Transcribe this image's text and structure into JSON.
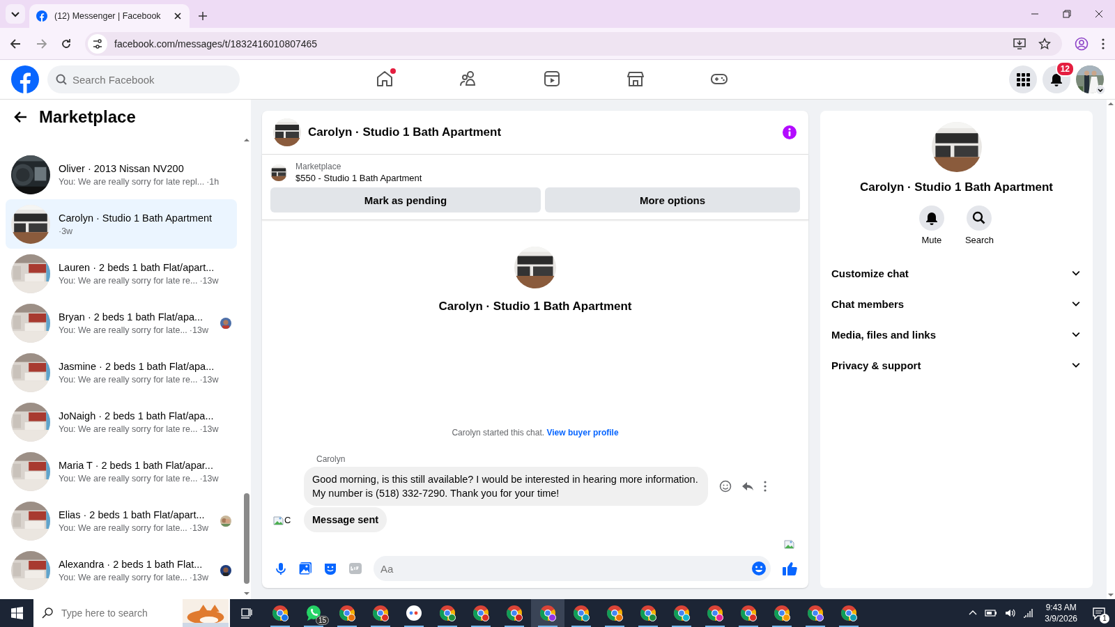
{
  "browser": {
    "tabs": [
      {
        "title": "(12) Messenger | Facebook",
        "selected": true
      }
    ],
    "url": "facebook.com/messages/t/1832416010807465"
  },
  "header": {
    "search": {
      "placeholder": "Search Facebook"
    },
    "nav": [
      {
        "kind": "home",
        "selected": false,
        "dot": true
      },
      {
        "kind": "friends",
        "selected": false,
        "dot": false
      },
      {
        "kind": "video",
        "selected": false,
        "dot": false
      },
      {
        "kind": "marketplace",
        "selected": false,
        "dot": false
      },
      {
        "kind": "gaming",
        "selected": false,
        "dot": false
      }
    ],
    "notifications_badge": "12"
  },
  "sidebar": {
    "title": "Marketplace",
    "conversations": [
      {
        "name": "Oliver · 2013 Nissan NV200",
        "preview": "You: We are really sorry for late repl...",
        "time": "·1h",
        "selected": false,
        "seen": false
      },
      {
        "name": "Carolyn · Studio 1 Bath Apartment",
        "time": "·3w",
        "selected": true,
        "seen": false
      },
      {
        "name": "Lauren · 2 beds 1 bath Flat/apart...",
        "preview": "You: We are really sorry for late re...",
        "time": "·13w",
        "selected": false,
        "seen": false
      },
      {
        "name": "Bryan · 2 beds 1 bath Flat/apa...",
        "preview": "You: We are really sorry for late...",
        "time": "·13w",
        "selected": false,
        "seen": true
      },
      {
        "name": "Jasmine · 2 beds 1 bath Flat/apa...",
        "preview": "You: We are really sorry for late re...",
        "time": "·13w",
        "selected": false,
        "seen": false
      },
      {
        "name": "JoNaigh · 2 beds 1 bath Flat/apa...",
        "preview": "You: We are really sorry for late re...",
        "time": "·13w",
        "selected": false,
        "seen": false
      },
      {
        "name": "Maria T · 2 beds 1 bath Flat/apar...",
        "preview": "You: We are really sorry for late re...",
        "time": "·13w",
        "selected": false,
        "seen": false
      },
      {
        "name": "Elias · 2 beds 1 bath Flat/apart...",
        "preview": "You: We are really sorry for late...",
        "time": "·13w",
        "selected": false,
        "seen": true
      },
      {
        "name": "Alexandra · 2 beds 1 bath Flat...",
        "preview": "You: We are really sorry for late...",
        "time": "·13w",
        "selected": false,
        "seen": true
      }
    ]
  },
  "chat": {
    "title": "Carolyn · Studio 1 Bath Apartment",
    "listing": {
      "label": "Marketplace",
      "title": "$550 - Studio 1 Bath Apartment"
    },
    "buttons": [
      "Mark as pending",
      "More options"
    ],
    "intro_name": "Carolyn · Studio 1 Bath Apartment",
    "started": {
      "text": "Carolyn started this chat.",
      "link": "View buyer profile"
    },
    "sender": "Carolyn",
    "messages": [
      {
        "kind": "text",
        "text": "Good morning, is this still available? I would be interested in hearing more information. My number is (518) 332-7290. Thank you for your time!",
        "actions_visible": true
      },
      {
        "kind": "status",
        "text": "Message sent",
        "actions_visible": false
      }
    ],
    "avatar_alt": "C",
    "composer": {
      "placeholder": "Aa"
    }
  },
  "details": {
    "name": "Carolyn · Studio 1 Bath Apartment",
    "actions": [
      {
        "kind": "mute",
        "label": "Mute"
      },
      {
        "kind": "search",
        "label": "Search"
      }
    ],
    "sections": [
      {
        "label": "Customize chat",
        "expanded": false
      },
      {
        "label": "Chat members",
        "expanded": false
      },
      {
        "label": "Media, files and links",
        "expanded": false
      },
      {
        "label": "Privacy & support",
        "expanded": false
      }
    ]
  },
  "taskbar": {
    "search": {
      "placeholder": "Type here to search"
    },
    "apps": [
      {
        "kind": "chrome",
        "color": "#1a73e8",
        "active": false
      },
      {
        "kind": "whatsapp",
        "color": "#25d366",
        "active": false,
        "badge": "15"
      },
      {
        "kind": "chrome",
        "color": "#e8710a",
        "active": false
      },
      {
        "kind": "chrome",
        "color": "#d93025",
        "active": false
      },
      {
        "kind": "dots",
        "color": "#ffffff",
        "active": false
      },
      {
        "kind": "chrome",
        "color": "#1e8e3e",
        "active": false
      },
      {
        "kind": "chrome",
        "color": "#d93025",
        "active": false
      },
      {
        "kind": "chrome",
        "color": "#c5221f",
        "active": false
      },
      {
        "kind": "chrome",
        "color": "#9334e6",
        "active": true
      },
      {
        "kind": "chrome",
        "color": "#129eaf",
        "active": false
      },
      {
        "kind": "chrome",
        "color": "#e8710a",
        "active": false
      },
      {
        "kind": "chrome",
        "color": "#1e8e3e",
        "active": false
      },
      {
        "kind": "chrome",
        "color": "#12b5cb",
        "active": false
      },
      {
        "kind": "chrome",
        "color": "#e52592",
        "active": false
      },
      {
        "kind": "chrome",
        "color": "#d93025",
        "active": false
      },
      {
        "kind": "chrome",
        "color": "#f29900",
        "active": false
      },
      {
        "kind": "chrome",
        "color": "#7b61ff",
        "active": false
      },
      {
        "kind": "chrome",
        "color": "#129eaf",
        "active": false
      }
    ],
    "time": "9:43 AM",
    "date": "3/9/2026",
    "notification_count": "1"
  }
}
